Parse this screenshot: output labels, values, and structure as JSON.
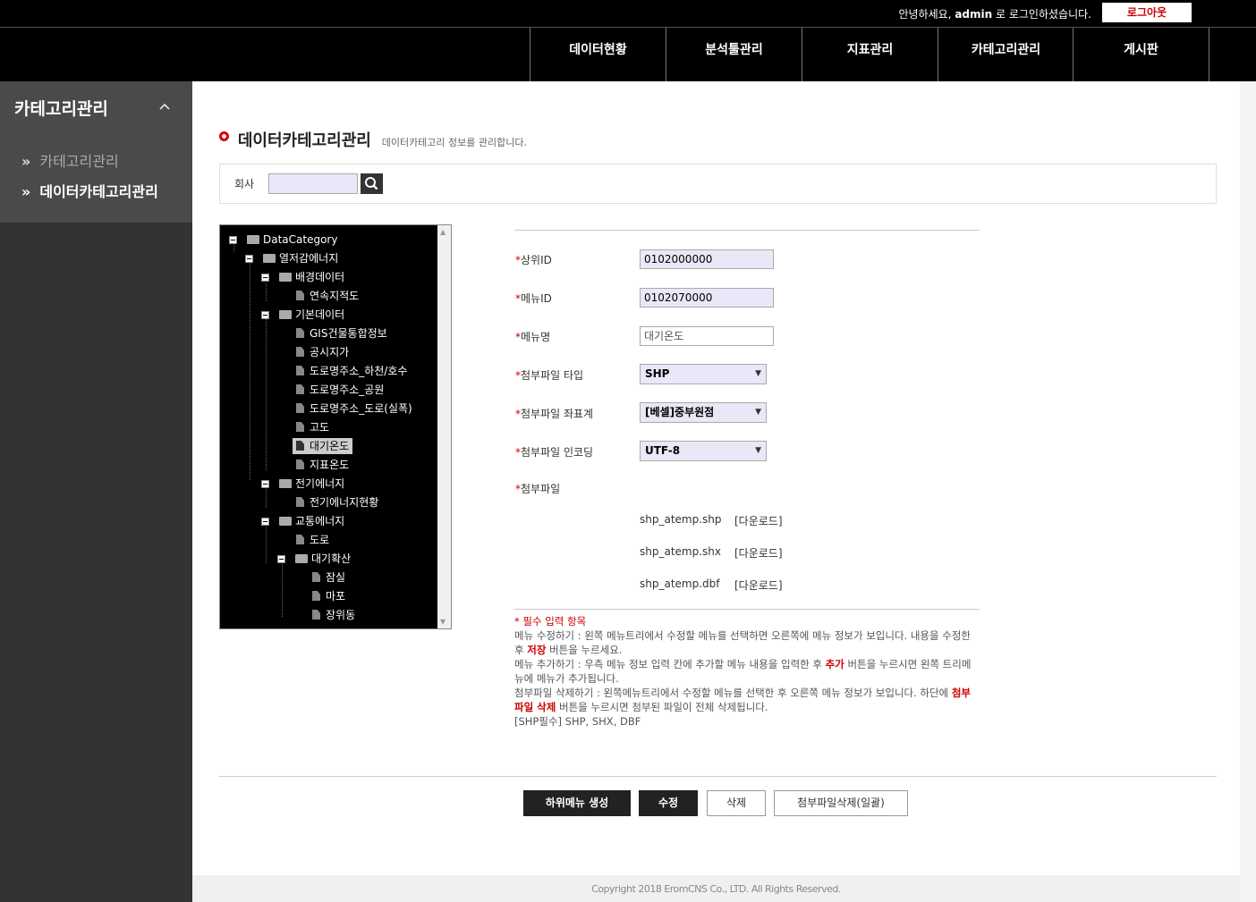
{
  "header": {
    "greeting_prefix": "안녕하세요,",
    "username": "admin",
    "greeting_suffix": "로 로그인하셨습니다.",
    "logout_label": "로그아웃"
  },
  "nav": {
    "items": [
      {
        "label": "데이터현황"
      },
      {
        "label": "분석툴관리"
      },
      {
        "label": "지표관리"
      },
      {
        "label": "카테고리관리"
      },
      {
        "label": "게시판"
      }
    ]
  },
  "sidebar": {
    "title": "카테고리관리",
    "collapse_icon": "chevron-up-icon",
    "items": [
      {
        "label": "카테고리관리",
        "active": false
      },
      {
        "label": "데이터카테고리관리",
        "active": true
      }
    ]
  },
  "page": {
    "title": "데이터카테고리관리",
    "description": "데이터카테고리 정보를 관리합니다."
  },
  "search": {
    "label": "회사",
    "value": "",
    "button_icon": "search-icon"
  },
  "tree": {
    "nodes": [
      {
        "label": "DataCategory",
        "type": "folder",
        "depth": 0
      },
      {
        "label": "열저감에너지",
        "type": "folder",
        "depth": 1
      },
      {
        "label": "배경데이터",
        "type": "folder",
        "depth": 2
      },
      {
        "label": "연속지적도",
        "type": "file",
        "depth": 3
      },
      {
        "label": "기본데이터",
        "type": "folder",
        "depth": 2
      },
      {
        "label": "GIS건물통합정보",
        "type": "file",
        "depth": 3
      },
      {
        "label": "공시지가",
        "type": "file",
        "depth": 3
      },
      {
        "label": "도로명주소_하천/호수",
        "type": "file",
        "depth": 3
      },
      {
        "label": "도로명주소_공원",
        "type": "file",
        "depth": 3
      },
      {
        "label": "도로명주소_도로(실폭)",
        "type": "file",
        "depth": 3
      },
      {
        "label": "고도",
        "type": "file",
        "depth": 3
      },
      {
        "label": "대기온도",
        "type": "file",
        "depth": 3,
        "selected": true
      },
      {
        "label": "지표온도",
        "type": "file",
        "depth": 3
      },
      {
        "label": "전기에너지",
        "type": "folder",
        "depth": 2
      },
      {
        "label": "전기에너지현황",
        "type": "file",
        "depth": 3
      },
      {
        "label": "교통에너지",
        "type": "folder",
        "depth": 2
      },
      {
        "label": "도로",
        "type": "file",
        "depth": 3
      },
      {
        "label": "대기확산",
        "type": "folder",
        "depth": 3
      },
      {
        "label": "잠실",
        "type": "file",
        "depth": 4
      },
      {
        "label": "마포",
        "type": "file",
        "depth": 4
      },
      {
        "label": "장위동",
        "type": "file",
        "depth": 4
      }
    ]
  },
  "form": {
    "required_mark": "*",
    "parent_id": {
      "label": "상위ID",
      "value": "0102000000"
    },
    "menu_id": {
      "label": "메뉴ID",
      "value": "0102070000"
    },
    "menu_name": {
      "label": "메뉴명",
      "value": "대기온도"
    },
    "file_type": {
      "label": "첨부파일 타입",
      "selected": "SHP"
    },
    "file_crs": {
      "label": "첨부파일 좌표계",
      "selected": "[베셀]중부원점"
    },
    "file_encoding": {
      "label": "첨부파일 인코딩",
      "selected": "UTF-8"
    },
    "attachment": {
      "label": "첨부파일"
    },
    "files": [
      {
        "name": "shp_atemp.shp",
        "link": "[다운로드]"
      },
      {
        "name": "shp_atemp.shx",
        "link": "[다운로드]"
      },
      {
        "name": "shp_atemp.dbf",
        "link": "[다운로드]"
      }
    ]
  },
  "help": {
    "required_note": "* 필수 입력 항목",
    "edit_1": "메뉴 수정하기 : 왼쪽 메뉴트리에서 수정할 메뉴를 선택하면 오른쪽에 메뉴 정보가 보입니다. 내용을 수정한 후 ",
    "edit_hl": "저장",
    "edit_2": " 버튼을 누르세요.",
    "add_1": "메뉴 추가하기 : 우측 메뉴 정보 입력 칸에 추가할 메뉴 내용을 입력한 후 ",
    "add_hl": "추가",
    "add_2": " 버튼을 누르시면 왼쪽 트리메뉴에 메뉴가 추가됩니다.",
    "del_1": "첨부파일 삭제하기 : 왼쪽메뉴트리에서 수정할 메뉴를 선택한 후 오른쪽 메뉴 정보가 보입니다. 하단에 ",
    "del_hl": "첨부파일 삭제",
    "del_2": " 버튼을 누르시면 첨부된 파일이 전체 삭제됩니다.",
    "shp_note": "[SHP필수] SHP, SHX, DBF"
  },
  "buttons": {
    "create_submenu": "하위메뉴 생성",
    "edit": "수정",
    "delete": "삭제",
    "delete_attachments": "첨부파일삭제(일괄)"
  },
  "footer": {
    "copyright": "Copyright 2018 EromCNS Co., LTD. All Rights Reserved."
  }
}
